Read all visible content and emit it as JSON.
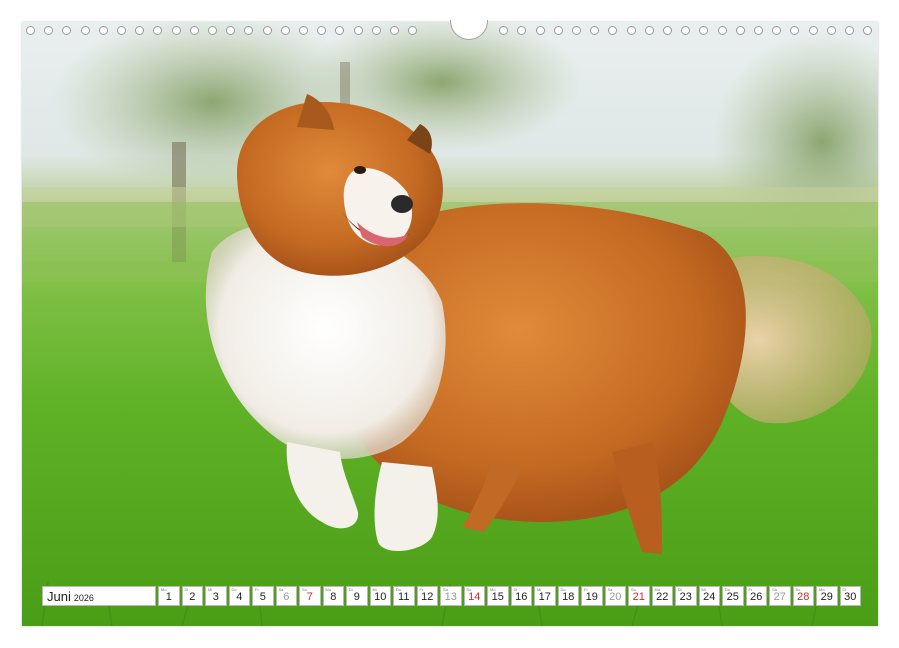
{
  "calendar": {
    "month": "Juni",
    "year": "2026",
    "days": [
      {
        "wd": "Mo",
        "num": "1",
        "type": "weekday"
      },
      {
        "wd": "Di",
        "num": "2",
        "type": "weekday"
      },
      {
        "wd": "Mi",
        "num": "3",
        "type": "weekday"
      },
      {
        "wd": "Do",
        "num": "4",
        "type": "weekday"
      },
      {
        "wd": "Fr",
        "num": "5",
        "type": "weekday"
      },
      {
        "wd": "Sa",
        "num": "6",
        "type": "sat"
      },
      {
        "wd": "So",
        "num": "7",
        "type": "sun"
      },
      {
        "wd": "Mo",
        "num": "8",
        "type": "weekday"
      },
      {
        "wd": "Di",
        "num": "9",
        "type": "weekday"
      },
      {
        "wd": "Mi",
        "num": "10",
        "type": "weekday"
      },
      {
        "wd": "Do",
        "num": "11",
        "type": "weekday"
      },
      {
        "wd": "Fr",
        "num": "12",
        "type": "weekday"
      },
      {
        "wd": "Sa",
        "num": "13",
        "type": "sat"
      },
      {
        "wd": "So",
        "num": "14",
        "type": "sun"
      },
      {
        "wd": "Mo",
        "num": "15",
        "type": "weekday"
      },
      {
        "wd": "Di",
        "num": "16",
        "type": "weekday"
      },
      {
        "wd": "Mi",
        "num": "17",
        "type": "weekday"
      },
      {
        "wd": "Do",
        "num": "18",
        "type": "weekday"
      },
      {
        "wd": "Fr",
        "num": "19",
        "type": "weekday"
      },
      {
        "wd": "Sa",
        "num": "20",
        "type": "sat"
      },
      {
        "wd": "So",
        "num": "21",
        "type": "sun"
      },
      {
        "wd": "Mo",
        "num": "22",
        "type": "weekday"
      },
      {
        "wd": "Di",
        "num": "23",
        "type": "weekday"
      },
      {
        "wd": "Mi",
        "num": "24",
        "type": "weekday"
      },
      {
        "wd": "Do",
        "num": "25",
        "type": "weekday"
      },
      {
        "wd": "Fr",
        "num": "26",
        "type": "weekday"
      },
      {
        "wd": "Sa",
        "num": "27",
        "type": "sat"
      },
      {
        "wd": "So",
        "num": "28",
        "type": "sun"
      },
      {
        "wd": "Mo",
        "num": "29",
        "type": "weekday"
      },
      {
        "wd": "Di",
        "num": "30",
        "type": "weekday"
      }
    ]
  },
  "photo": {
    "subject_icon": "dog-photo",
    "colors": {
      "grass": "#5aae22",
      "sky": "#e9efef",
      "fur_orange": "#c96f2a",
      "fur_white": "#f6f3ee",
      "sunday_red": "#d0262a"
    }
  }
}
